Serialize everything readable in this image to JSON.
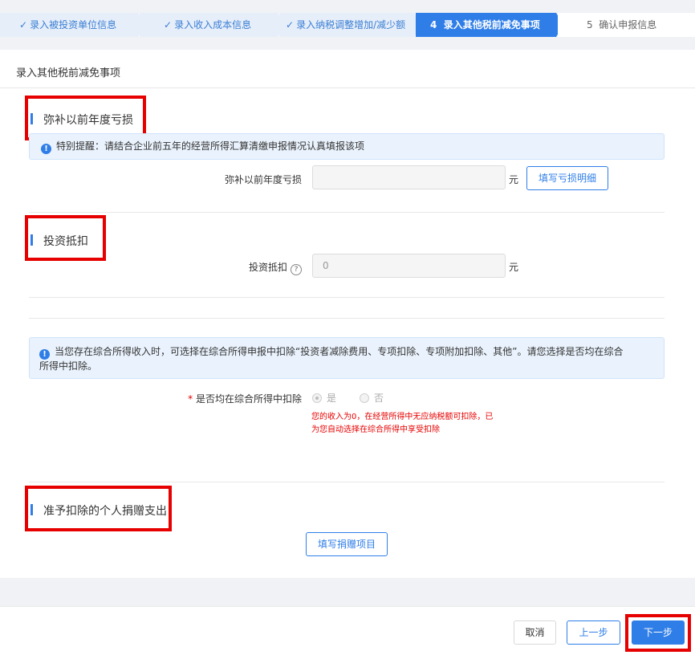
{
  "steps": [
    {
      "label": "录入被投资单位信息",
      "status": "done"
    },
    {
      "label": "录入收入成本信息",
      "status": "done"
    },
    {
      "label": "录入纳税调整增加/减少额",
      "status": "done"
    },
    {
      "number": "4",
      "label": "录入其他税前减免事项",
      "status": "active"
    },
    {
      "number": "5",
      "label": "确认申报信息",
      "status": "todo"
    }
  ],
  "panel": {
    "title": "录入其他税前减免事项"
  },
  "section_loss": {
    "title": "弥补以前年度亏损",
    "tip": "特别提醒：请结合企业前五年的经营所得汇算清缴申报情况认真填报该项",
    "field_label": "弥补以前年度亏损",
    "value": "",
    "unit": "元",
    "detail_button": "填写亏损明细"
  },
  "section_invest": {
    "title": "投资抵扣",
    "field_label": "投资抵扣",
    "value": "0",
    "unit": "元"
  },
  "section_comprehensive": {
    "tip_line1": "当您存在综合所得收入时，可选择在综合所得申报中扣除“投资者减除费用、专项扣除、专项附加扣除、其他”。请您选择是否均在综合",
    "tip_line2": "所得中扣除。",
    "required_mark": "*",
    "question": "是否均在综合所得中扣除",
    "option_yes": "是",
    "option_no": "否",
    "selected": "是",
    "warning_line1": "您的收入为0，在经营所得中无应纳税额可扣除，已",
    "warning_line2": "为您自动选择在综合所得中享受扣除"
  },
  "section_donation": {
    "title": "准予扣除的个人捐赠支出",
    "button": "填写捐赠项目"
  },
  "footer": {
    "cancel": "取消",
    "prev": "上一步",
    "next": "下一步"
  },
  "colors": {
    "primary": "#2f7ee8",
    "highlight": "#e60000",
    "warning_text": "#e60000"
  }
}
